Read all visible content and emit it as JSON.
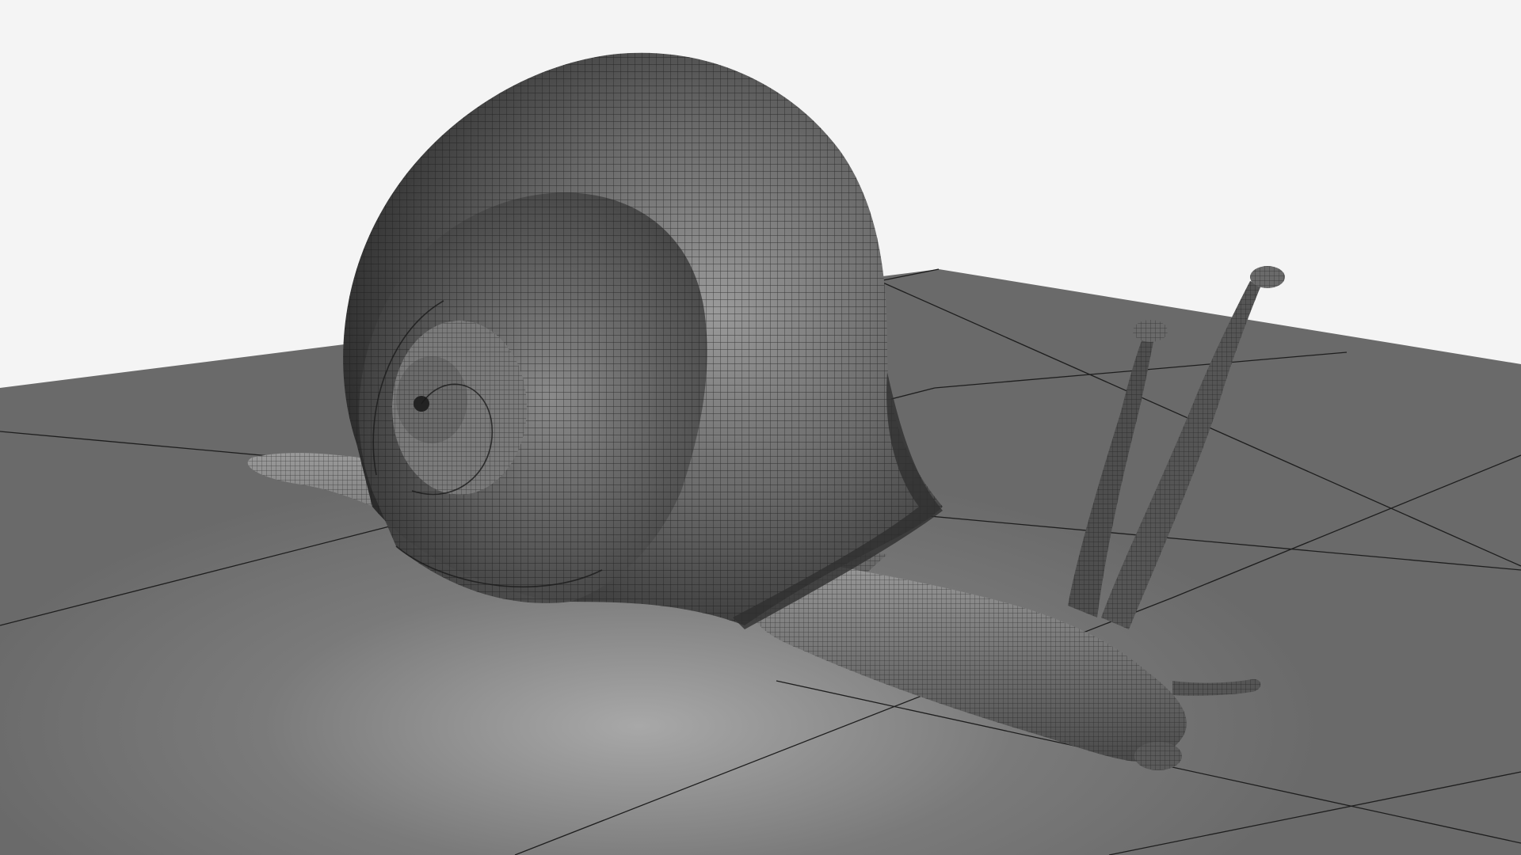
{
  "scene": {
    "subject": "snail-wireframe-model",
    "background_color": "#f4f4f4",
    "floor_color": "#6e6e6e",
    "floor_highlight_color": "#a8a8a8",
    "floor_line_color": "#1e1e1e",
    "mesh_fill_light": "#8a8a8a",
    "mesh_fill_dark": "#3c3c3c",
    "mesh_line_color": "#1a1a1a"
  }
}
